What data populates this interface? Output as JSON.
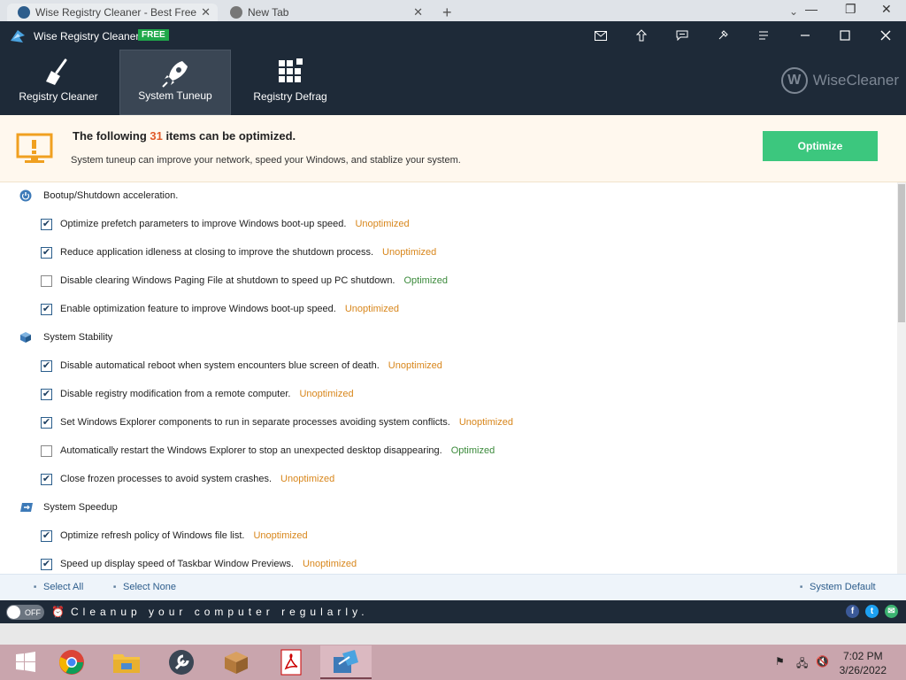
{
  "browser": {
    "tabs": [
      {
        "label": "Wise Registry Cleaner - Best Free"
      },
      {
        "label": "New Tab"
      }
    ],
    "new_tab": "+",
    "tab_close": "✕",
    "chevron": "⌄",
    "window_controls": [
      "—",
      "❐",
      "✕"
    ]
  },
  "app": {
    "title": "Wise Registry Cleaner X",
    "badge": "FREE",
    "title_buttons": [
      "mail-icon",
      "upload-icon",
      "feedback-icon",
      "skin-icon",
      "menu-icon",
      "minimize-icon",
      "maximize-icon",
      "close-icon"
    ],
    "tools": [
      {
        "label": "Registry Cleaner",
        "icon": "broom-icon"
      },
      {
        "label": "System Tuneup",
        "icon": "rocket-icon"
      },
      {
        "label": "Registry Defrag",
        "icon": "defrag-icon"
      }
    ],
    "brand": {
      "initial": "W",
      "name": "WiseCleaner"
    }
  },
  "banner": {
    "headline_pre": "The following",
    "count": "31",
    "headline_post": "items can be optimized.",
    "subtitle": "System tuneup can improve your network, speed your Windows, and stablize your system.",
    "button": "Optimize"
  },
  "sections": [
    {
      "title": "Bootup/Shutdown acceleration.",
      "icon": "power-icon",
      "items": [
        {
          "label": "Optimize prefetch parameters to improve Windows boot-up speed.",
          "status": "Unoptimized",
          "checked": true
        },
        {
          "label": "Reduce application idleness at closing to improve the shutdown process.",
          "status": "Unoptimized",
          "checked": true
        },
        {
          "label": "Disable clearing Windows Paging File at shutdown to speed up PC shutdown.",
          "status": "Optimized",
          "checked": false
        },
        {
          "label": "Enable optimization feature to improve Windows boot-up speed.",
          "status": "Unoptimized",
          "checked": true
        }
      ]
    },
    {
      "title": "System Stability",
      "icon": "cube-icon",
      "items": [
        {
          "label": "Disable automatical reboot when system encounters blue screen of death.",
          "status": "Unoptimized",
          "checked": true
        },
        {
          "label": "Disable registry modification from a remote computer.",
          "status": "Unoptimized",
          "checked": true
        },
        {
          "label": "Set Windows Explorer components to run in separate processes avoiding system conflicts.",
          "status": "Unoptimized",
          "checked": true
        },
        {
          "label": "Automatically restart the Windows Explorer to stop an unexpected desktop disappearing.",
          "status": "Optimized",
          "checked": false
        },
        {
          "label": "Close frozen processes to avoid system crashes.",
          "status": "Unoptimized",
          "checked": true
        }
      ]
    },
    {
      "title": "System Speedup",
      "icon": "speed-icon",
      "items": [
        {
          "label": "Optimize refresh policy of Windows file list.",
          "status": "Unoptimized",
          "checked": true
        },
        {
          "label": "Speed up display speed of Taskbar Window Previews.",
          "status": "Unoptimized",
          "checked": true
        }
      ]
    }
  ],
  "footer": {
    "select_all": "Select All",
    "select_none": "Select None",
    "system_default": "System Default"
  },
  "statusbar": {
    "toggle": "OFF",
    "message": "Cleanup your computer regularly.",
    "social": [
      "facebook-icon",
      "twitter-icon",
      "email-icon"
    ]
  },
  "taskbar": {
    "apps": [
      "windows-start-icon",
      "chrome-icon",
      "file-explorer-icon",
      "tools-icon",
      "package-icon",
      "pdf-icon",
      "wise-registry-icon"
    ],
    "time": "7:02 PM",
    "date": "3/26/2022"
  },
  "colors": {
    "titlebar": "#1e2a38",
    "optimize_button": "#3cc77e",
    "unoptimized": "#d8861b",
    "optimized": "#3b8a3b",
    "count": "#e05a2a"
  }
}
